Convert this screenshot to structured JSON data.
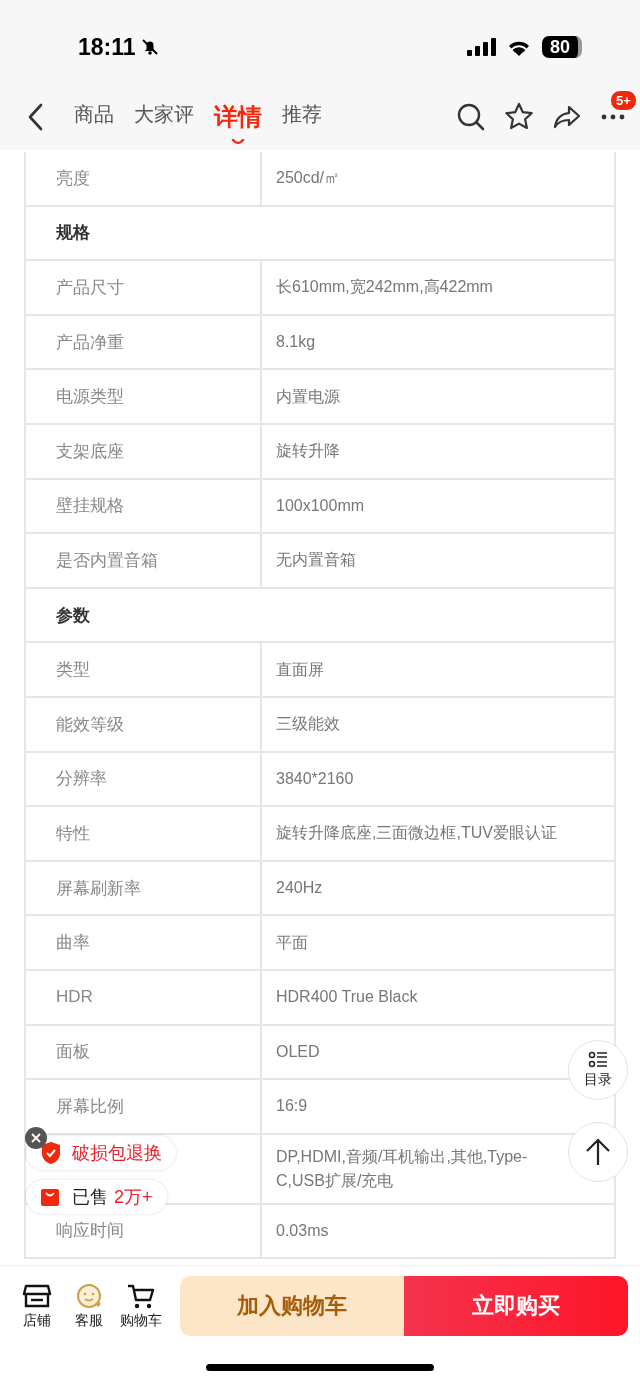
{
  "status_bar": {
    "time": "18:11",
    "silent": true,
    "battery": "80"
  },
  "nav": {
    "tabs": [
      {
        "label": "商品",
        "selected": false
      },
      {
        "label": "大家评",
        "selected": false
      },
      {
        "label": "详情",
        "selected": true
      },
      {
        "label": "推荐",
        "selected": false
      }
    ],
    "more_badge": "5+"
  },
  "spec_rows": [
    {
      "kind": "row",
      "label": "亮度",
      "value": "250cd/㎡"
    },
    {
      "kind": "section",
      "label": "规格"
    },
    {
      "kind": "row",
      "label": "产品尺寸",
      "value": "长610mm,宽242mm,高422mm"
    },
    {
      "kind": "row",
      "label": "产品净重",
      "value": "8.1kg"
    },
    {
      "kind": "row",
      "label": "电源类型",
      "value": "内置电源"
    },
    {
      "kind": "row",
      "label": "支架底座",
      "value": "旋转升降"
    },
    {
      "kind": "row",
      "label": "壁挂规格",
      "value": "100x100mm"
    },
    {
      "kind": "row",
      "label": "是否内置音箱",
      "value": "无内置音箱"
    },
    {
      "kind": "section",
      "label": "参数"
    },
    {
      "kind": "row",
      "label": "类型",
      "value": "直面屏"
    },
    {
      "kind": "row",
      "label": "能效等级",
      "value": "三级能效"
    },
    {
      "kind": "row",
      "label": "分辨率",
      "value": "3840*2160"
    },
    {
      "kind": "row",
      "label": "特性",
      "value": "旋转升降底座,三面微边框,TUV爱眼认证"
    },
    {
      "kind": "row",
      "label": "屏幕刷新率",
      "value": "240Hz"
    },
    {
      "kind": "row",
      "label": "曲率",
      "value": "平面"
    },
    {
      "kind": "row",
      "label": "HDR",
      "value": "HDR400 True Black"
    },
    {
      "kind": "row",
      "label": "面板",
      "value": "OLED"
    },
    {
      "kind": "row",
      "label": "屏幕比例",
      "value": "16:9"
    },
    {
      "kind": "row",
      "value": "DP,HDMI,音频/耳机输出,其他,Type-C,USB扩展/充电"
    },
    {
      "kind": "row",
      "label": "响应时间",
      "value": "0.03ms"
    }
  ],
  "floating": {
    "guarantee": "破损包退换",
    "sold_prefix": "已售",
    "sold_count": "2万+",
    "toc": "目录"
  },
  "bottom_bar": {
    "icons": [
      {
        "label": "店铺",
        "kind": "shop"
      },
      {
        "label": "客服",
        "kind": "service"
      },
      {
        "label": "购物车",
        "kind": "cart"
      }
    ],
    "add_to_cart": "加入购物车",
    "buy_now": "立即购买"
  }
}
